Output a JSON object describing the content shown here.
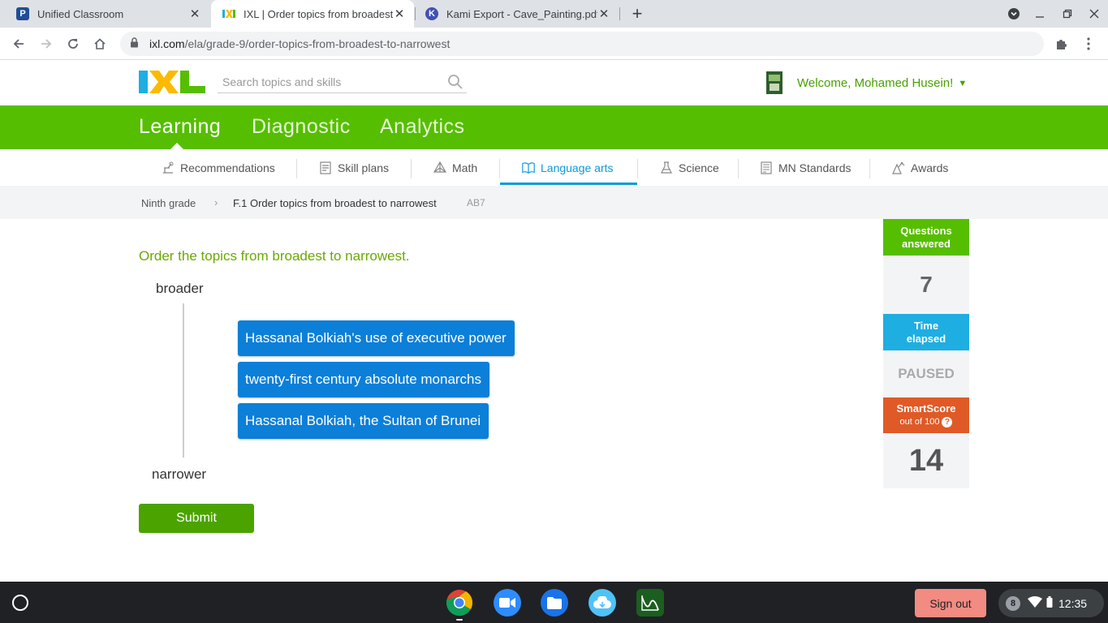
{
  "browser": {
    "tabs": [
      {
        "title": "Unified Classroom",
        "favicon": "P",
        "favicon_color": "#1f4e96",
        "active": false
      },
      {
        "title": "IXL | Order topics from broadest t",
        "favicon": "IXL",
        "favicon_color": "#56be00",
        "active": true
      },
      {
        "title": "Kami Export - Cave_Painting.pdf",
        "favicon": "K",
        "favicon_color": "#3f51b5",
        "active": false
      }
    ],
    "url_host": "ixl.com",
    "url_path": "/ela/grade-9/order-topics-from-broadest-to-narrowest"
  },
  "header": {
    "logo": {
      "i": "I",
      "x": "X",
      "l": "L"
    },
    "search_placeholder": "Search topics and skills",
    "welcome": "Welcome, Mohamed Husein!"
  },
  "main_nav": [
    "Learning",
    "Diagnostic",
    "Analytics"
  ],
  "subject_nav": [
    {
      "label": "Recommendations",
      "icon": "recommendations-icon"
    },
    {
      "label": "Skill plans",
      "icon": "skill-plans-icon"
    },
    {
      "label": "Math",
      "icon": "math-icon"
    },
    {
      "label": "Language arts",
      "icon": "language-arts-icon"
    },
    {
      "label": "Science",
      "icon": "science-icon"
    },
    {
      "label": "MN Standards",
      "icon": "standards-icon"
    },
    {
      "label": "Awards",
      "icon": "awards-icon"
    }
  ],
  "breadcrumb": {
    "grade": "Ninth grade",
    "skill": "F.1 Order topics from broadest to narrowest",
    "code": "AB7"
  },
  "question": {
    "prompt": "Order the topics from broadest to narrowest.",
    "top_label": "broader",
    "bottom_label": "narrower",
    "tiles": [
      "Hassanal Bolkiah's use of executive power",
      "twenty-first century absolute monarchs",
      "Hassanal Bolkiah, the Sultan of Brunei"
    ],
    "submit": "Submit"
  },
  "stats": {
    "questions_label_1": "Questions",
    "questions_label_2": "answered",
    "questions_value": "7",
    "time_label_1": "Time",
    "time_label_2": "elapsed",
    "time_value": "PAUSED",
    "smartscore_label": "SmartScore",
    "smartscore_sub": "out of 100",
    "smartscore_help": "?",
    "smartscore_value": "14"
  },
  "colors": {
    "green_nav": "#56be00",
    "tile_blue": "#0c7fd9",
    "questions_head": "#56be00",
    "time_head": "#1eaee2",
    "smartscore_head": "#e05a27"
  },
  "shelf": {
    "sign_out": "Sign out",
    "notification_count": "8",
    "time": "12:35",
    "apps": [
      "chrome-icon",
      "zoom-icon",
      "files-icon",
      "cloud-icon",
      "geogebra-icon"
    ]
  }
}
